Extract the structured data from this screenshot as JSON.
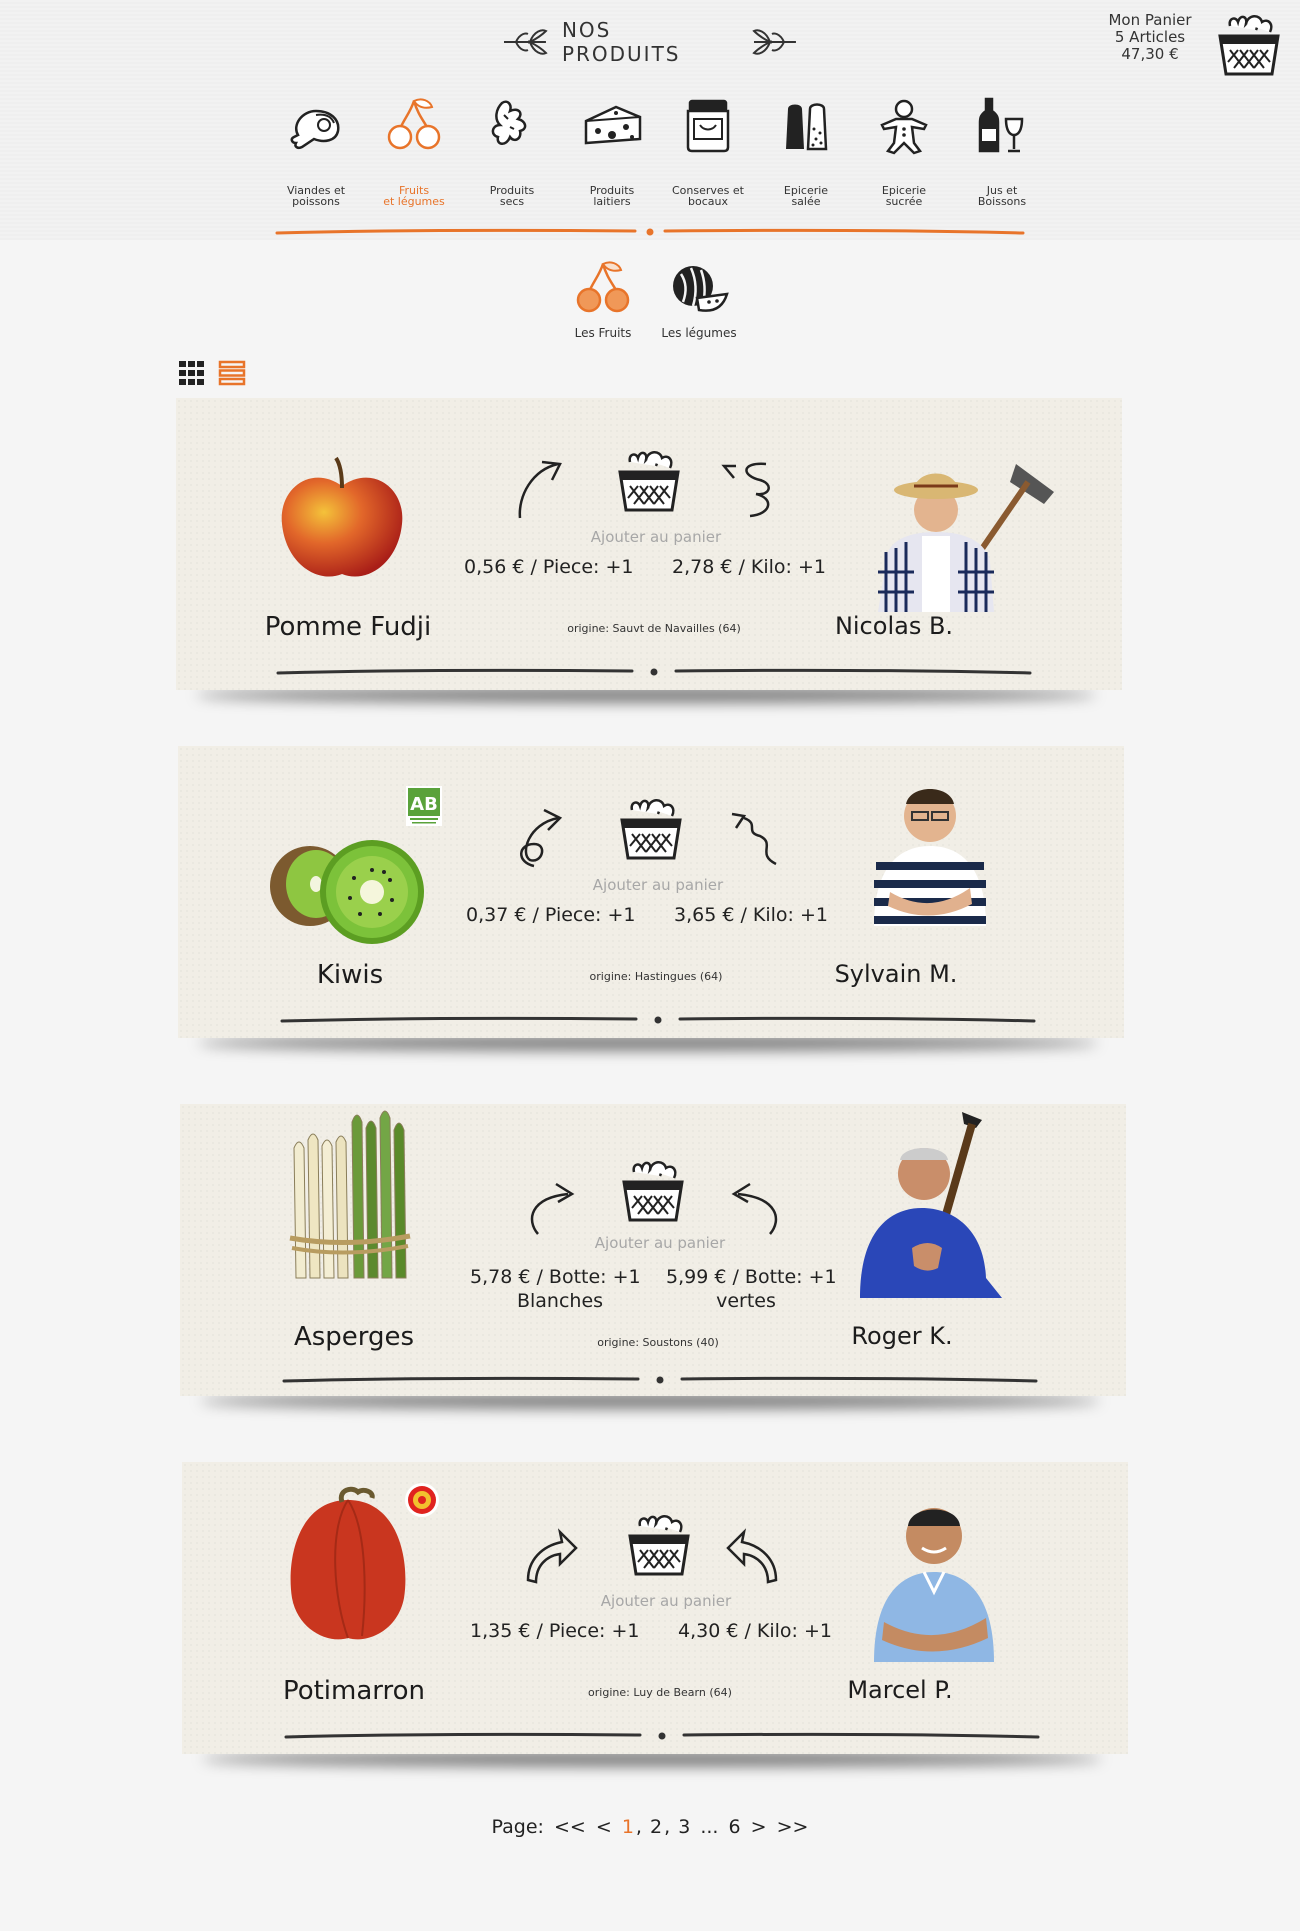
{
  "header": {
    "title": "NOS PRODUITS",
    "cart": {
      "line1": "Mon Panier",
      "line2": "5 Articles",
      "line3": "47,30 €"
    }
  },
  "categories": [
    {
      "label": "Viandes et\npoissons",
      "icon": "meat-icon"
    },
    {
      "label": "Fruits\net légumes",
      "icon": "cherries-icon",
      "active": true
    },
    {
      "label": "Produits\nsecs",
      "icon": "ginger-icon"
    },
    {
      "label": "Produits\nlaitiers",
      "icon": "cheese-icon"
    },
    {
      "label": "Conserves et\nbocaux",
      "icon": "jar-icon"
    },
    {
      "label": "Epicerie\nsalée",
      "icon": "salt-pepper-icon"
    },
    {
      "label": "Epicerie\nsucrée",
      "icon": "gingerbread-icon"
    },
    {
      "label": "Jus et\nBoissons",
      "icon": "wine-icon"
    }
  ],
  "subcategories": [
    {
      "label": "Les Fruits",
      "icon": "cherries-icon"
    },
    {
      "label": "Les légumes",
      "icon": "watermelon-icon"
    }
  ],
  "products": [
    {
      "name": "Pomme Fudji",
      "add_label": "Ajouter au panier",
      "price1": "0,56 € / Piece: +1",
      "price2": "2,78 € / Kilo: +1",
      "origin": "origine: Sauvt de Navailles (64)",
      "farmer": "Nicolas B."
    },
    {
      "name": "Kiwis",
      "add_label": "Ajouter au panier",
      "price1": "0,37 € / Piece: +1",
      "price2": "3,65 € / Kilo: +1",
      "origin": "origine: Hastingues (64)",
      "farmer": "Sylvain M.",
      "badge": "AB"
    },
    {
      "name": "Asperges",
      "add_label": "Ajouter au panier",
      "price1": "5,78 € / Botte: +1",
      "price2": "5,99 € / Botte: +1",
      "price1_sub": "Blanches",
      "price2_sub": "vertes",
      "origin": "origine: Soustons (40)",
      "farmer": "Roger K."
    },
    {
      "name": "Potimarron",
      "add_label": "Ajouter au panier",
      "price1": "1,35 € / Piece: +1",
      "price2": "4,30 € / Kilo: +1",
      "origin": "origine: Luy de Bearn (64)",
      "farmer": "Marcel P."
    }
  ],
  "pager": {
    "label": "Page:",
    "first": "<<",
    "prev": "<",
    "pages": [
      "1",
      "2",
      "3",
      "...",
      "6"
    ],
    "current": "1",
    "next": ">",
    "last": ">>"
  },
  "colors": {
    "accent": "#e8742a",
    "card": "#f1eee6",
    "background": "#f5f5f5"
  }
}
